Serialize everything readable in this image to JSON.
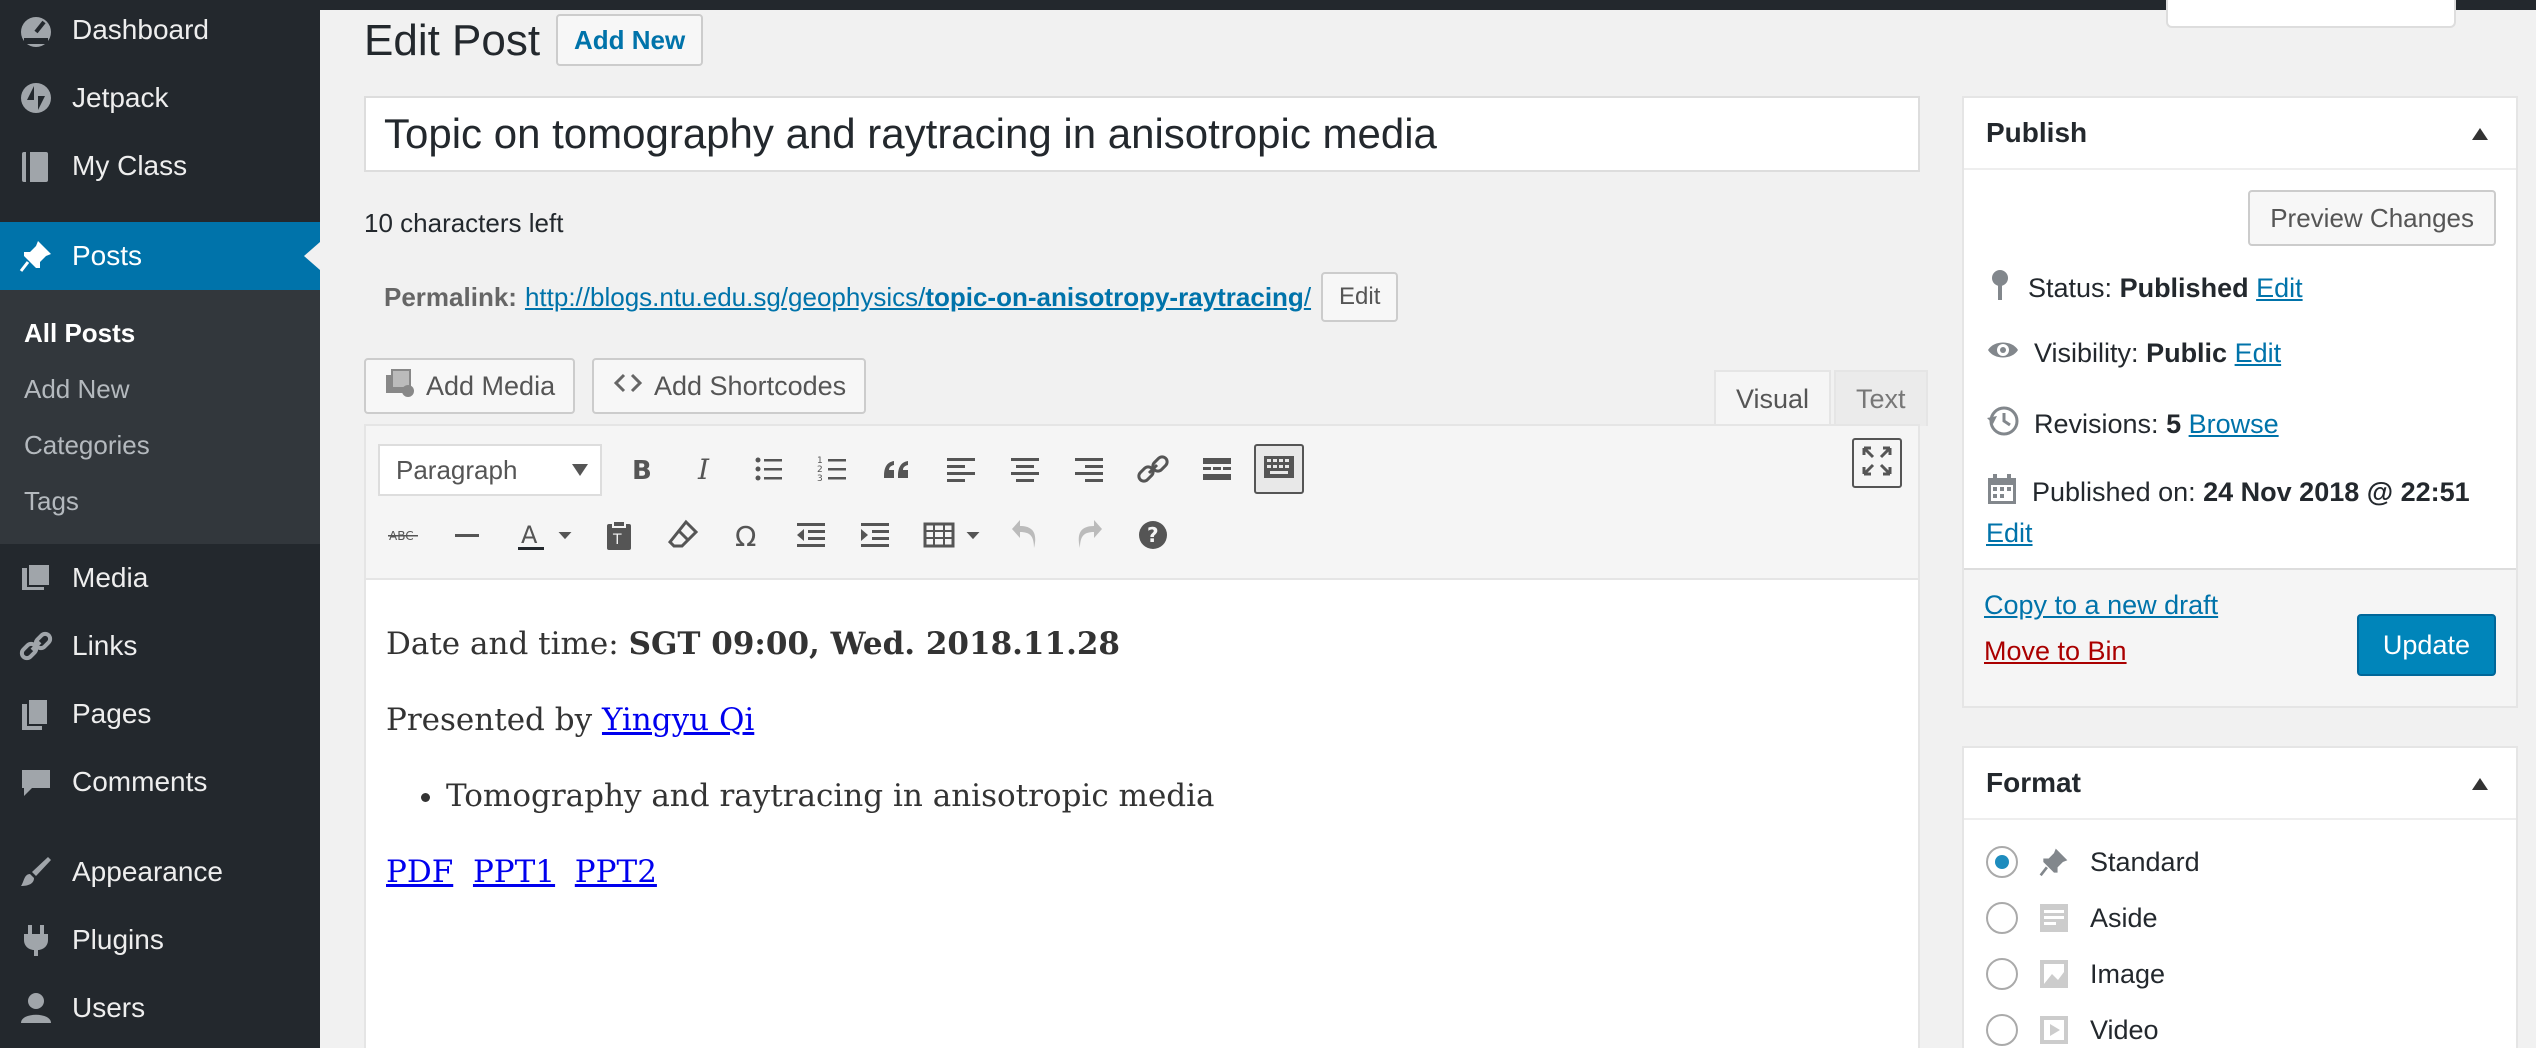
{
  "sidebar": {
    "menu": [
      {
        "label": "Dashboard",
        "icon": "dashboard-icon"
      },
      {
        "label": "Jetpack",
        "icon": "jetpack-icon"
      },
      {
        "label": "My Class",
        "icon": "book-icon"
      },
      {
        "label": "Posts",
        "icon": "pushpin-icon"
      },
      {
        "label": "Media",
        "icon": "media-icon"
      },
      {
        "label": "Links",
        "icon": "link-icon"
      },
      {
        "label": "Pages",
        "icon": "pages-icon"
      },
      {
        "label": "Comments",
        "icon": "comment-icon"
      },
      {
        "label": "Appearance",
        "icon": "paintbrush-icon"
      },
      {
        "label": "Plugins",
        "icon": "plugin-icon"
      },
      {
        "label": "Users",
        "icon": "user-icon"
      }
    ],
    "submenu": [
      "All Posts",
      "Add New",
      "Categories",
      "Tags"
    ]
  },
  "header": {
    "title": "Edit Post",
    "add_new": "Add New"
  },
  "post": {
    "title": "Topic on tomography and raytracing in anisotropic media",
    "chars_left": "10 characters left",
    "permalink_label": "Permalink:",
    "permalink_base": "http://blogs.ntu.edu.sg/geophysics/",
    "permalink_slug": "topic-on-anisotropy-raytracing",
    "permalink_tail": "/",
    "permalink_edit": "Edit"
  },
  "editor": {
    "add_media": "Add Media",
    "add_shortcodes": "Add Shortcodes",
    "tab_visual": "Visual",
    "tab_text": "Text",
    "format_select": "Paragraph",
    "content": {
      "date_label": "Date and time: ",
      "date_value": "SGT 09:00, Wed. 2018.11.28",
      "presented_by": "Presented by ",
      "presenter": "Yingyu Qi",
      "bullet": "Tomography and raytracing in anisotropic media",
      "links": [
        "PDF",
        "PPT1",
        "PPT2"
      ]
    }
  },
  "publish": {
    "title": "Publish",
    "preview": "Preview Changes",
    "status_label": "Status:",
    "status_value": "Published",
    "visibility_label": "Visibility:",
    "visibility_value": "Public",
    "revisions_label": "Revisions:",
    "revisions_value": "5",
    "browse": "Browse",
    "published_label": "Published on:",
    "published_value": "24 Nov 2018 @ 22:51",
    "edit": "Edit",
    "copy_draft": "Copy to a new draft",
    "move_to_bin": "Move to Bin",
    "update": "Update"
  },
  "format": {
    "title": "Format",
    "options": [
      "Standard",
      "Aside",
      "Image",
      "Video"
    ],
    "selected": "Standard"
  },
  "colors": {
    "admin_bg": "#23282d",
    "accent": "#0073aa",
    "primary_button": "#0085ba",
    "trash": "#a00"
  }
}
